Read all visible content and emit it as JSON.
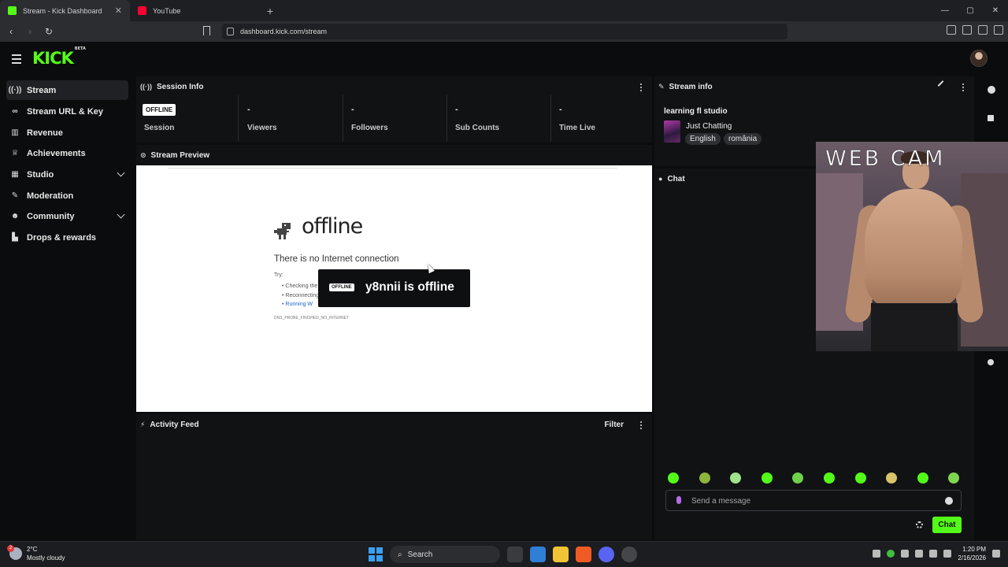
{
  "browser": {
    "tabs": [
      {
        "label": "Stream - Kick Dashboard",
        "favicon_color": "#53fc18"
      },
      {
        "label": "YouTube",
        "favicon_color": "#ff0033"
      }
    ],
    "new_tab": "+",
    "url": "dashboard.kick.com/stream"
  },
  "header": {
    "logo": "KICK",
    "logo_badge": "BETA"
  },
  "sidebar": {
    "items": [
      {
        "label": "Stream",
        "icon": "broadcast-icon"
      },
      {
        "label": "Stream URL & Key",
        "icon": "link-icon"
      },
      {
        "label": "Revenue",
        "icon": "chart-icon"
      },
      {
        "label": "Achievements",
        "icon": "trophy-icon"
      },
      {
        "label": "Studio",
        "icon": "studio-icon"
      },
      {
        "label": "Moderation",
        "icon": "wrench-icon"
      },
      {
        "label": "Community",
        "icon": "people-icon"
      },
      {
        "label": "Drops & rewards",
        "icon": "gift-icon"
      }
    ]
  },
  "session_info": {
    "title": "Session Info",
    "status_badge": "OFFLINE",
    "session_label": "Session",
    "stats": [
      {
        "value": "-",
        "label": "Viewers"
      },
      {
        "value": "-",
        "label": "Followers"
      },
      {
        "value": "-",
        "label": "Sub Counts"
      },
      {
        "value": "-",
        "label": "Time Live"
      }
    ]
  },
  "stream_preview": {
    "title": "Stream Preview",
    "offline_heading": "offline",
    "no_connection": "There is no Internet connection",
    "try_label": "Try:",
    "tips": [
      "Checking the",
      "Reconnecting",
      "Running W"
    ],
    "error_code": "DNS_PROBE_FINISHED_NO_INTERNET",
    "overlay_badge": "OFFLINE",
    "overlay_message": "y8nnii is offline"
  },
  "activity_feed": {
    "title": "Activity Feed",
    "filter_label": "Filter"
  },
  "stream_info": {
    "title": "Stream info",
    "stream_title": "learning fl studio",
    "category": "Just Chatting",
    "tags": [
      "English",
      "românia"
    ]
  },
  "chat": {
    "title": "Chat",
    "placeholder": "Send a message",
    "send_label": "Chat"
  },
  "webcam": {
    "overlay_text": "WEB CAM"
  },
  "taskbar": {
    "weather_temp": "2°C",
    "weather_desc": "Mostly cloudy",
    "weather_badge": "2",
    "search_label": "Search",
    "time": "1:20 PM",
    "date": "2/16/2026"
  }
}
